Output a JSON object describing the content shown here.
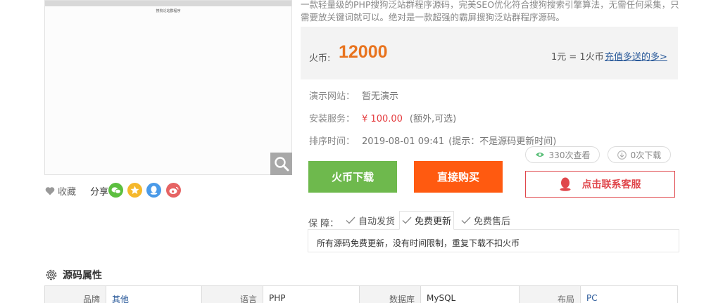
{
  "preview": {
    "tiny_caption": "搜狗泛站群程序"
  },
  "left_actions": {
    "favorite_label": "收藏",
    "share_label": "分享"
  },
  "description": "一款轻量级的PHP搜狗泛站群程序源码，完美SEO优化符合搜狗搜索引擎算法，无需任何采集，只需要放关键词就可以。绝对是一款超强的霸屏搜狗泛站群程序源码。",
  "price": {
    "currency_label": "火币:",
    "amount": "12000",
    "rate": "1元 = 1火币",
    "recharge_link": "充值多送的多>"
  },
  "info": {
    "demo_label": "演示网站：",
    "demo_value": "暂无演示",
    "install_label": "安装服务：",
    "install_price": "¥ 100.00",
    "install_note": "(额外,可选)",
    "sort_label": "排序时间：",
    "sort_value": "2019-08-01 09:41",
    "sort_note": "(提示：不是源码更新时间)"
  },
  "stats": {
    "views": "330次查看",
    "downloads": "0次下载"
  },
  "buttons": {
    "coin_download": "火币下载",
    "buy_now": "直接购买",
    "contact_service": "点击联系客服"
  },
  "guarantee": {
    "label": "保  障：",
    "items": [
      "自动发货",
      "免费更新",
      "免费售后"
    ],
    "active_index": 1,
    "panel_text": "所有源码免费更新，没有时间限制，重复下载不扣火币"
  },
  "attributes": {
    "title": "源码属性",
    "rows": [
      {
        "key": "品牌",
        "value": "其他",
        "link": true
      },
      {
        "key": "语言",
        "value": "PHP",
        "link": false
      },
      {
        "key": "数据库",
        "value": "MySQL",
        "link": false
      },
      {
        "key": "布局",
        "value": "PC",
        "link": true
      }
    ]
  },
  "colors": {
    "price": "#e8731e",
    "green_button": "#6eb94d",
    "orange_button": "#ff5a10",
    "service_red": "#e0474c",
    "link_blue": "#2a5a9a"
  }
}
